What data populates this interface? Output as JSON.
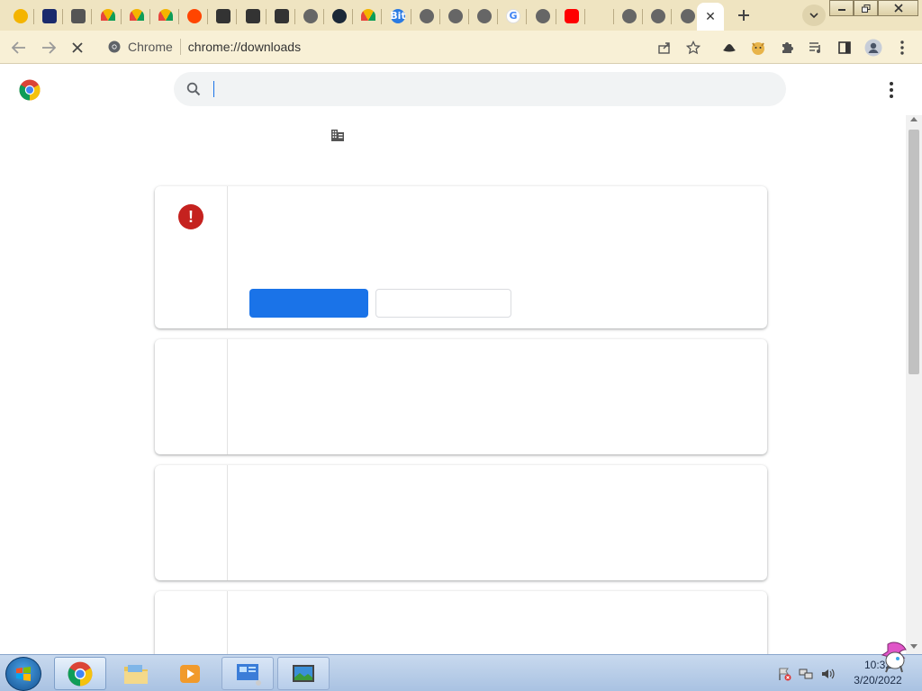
{
  "window": {
    "controls": [
      "minimize",
      "restore",
      "close"
    ]
  },
  "tabs": [
    {
      "icon": "red-triangle-extension-icon",
      "color": "#f4b400"
    },
    {
      "icon": "cursor-arrow-icon",
      "color": "#1a2a6c"
    },
    {
      "icon": "puzzle-icon",
      "color": "#555555"
    },
    {
      "icon": "rainbow-icon",
      "color": "#e8453c"
    },
    {
      "icon": "rainbow-icon",
      "color": "#e8453c"
    },
    {
      "icon": "rainbow-icon",
      "color": "#e8453c"
    },
    {
      "icon": "reddit-icon",
      "color": "#ff4500"
    },
    {
      "icon": "cube-icon",
      "color": "#333333"
    },
    {
      "icon": "cube-icon",
      "color": "#333333"
    },
    {
      "icon": "cube-icon",
      "color": "#333333"
    },
    {
      "icon": "chrome-gray-icon",
      "color": "#666666"
    },
    {
      "icon": "steam-icon",
      "color": "#1b2838"
    },
    {
      "icon": "rainbow-icon",
      "color": "#e8453c"
    },
    {
      "icon": "bit-tube-icon",
      "color": "#2a7ae2",
      "text": "Bit"
    },
    {
      "icon": "chrome-gray-icon",
      "color": "#666666"
    },
    {
      "icon": "globe-icon",
      "color": "#666666"
    },
    {
      "icon": "speaker-icon",
      "color": "#666666"
    },
    {
      "icon": "google-icon",
      "color": "#4285f4",
      "text": "G"
    },
    {
      "icon": "history-icon",
      "color": "#666666"
    },
    {
      "icon": "youtube-icon",
      "color": "#ff0000"
    },
    {
      "icon": "blank-icon",
      "color": "#efe4c1"
    },
    {
      "icon": "globe-icon",
      "color": "#666666"
    },
    {
      "icon": "chrome-gray-icon",
      "color": "#666666"
    },
    {
      "icon": "globe-icon",
      "color": "#666666"
    }
  ],
  "active_tab": {
    "close_glyph": "✕"
  },
  "toolbar": {
    "site_name": "Chrome",
    "url": "chrome://downloads"
  },
  "page": {
    "search_placeholder": ""
  },
  "taskbar": {
    "time": "10:32",
    "date": "3/20/2022"
  },
  "colors": {
    "tabstrip": "#efe4c1",
    "toolbar": "#f8f0d6",
    "accent": "#1a73e8",
    "error": "#c5221f"
  }
}
